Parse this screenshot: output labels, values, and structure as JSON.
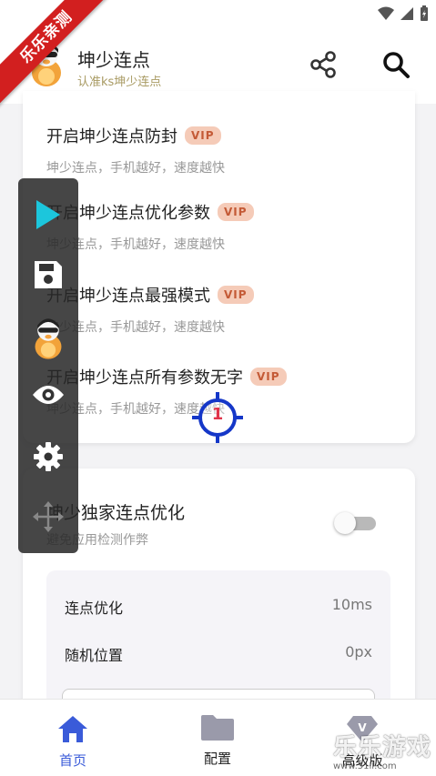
{
  "ribbon": "乐乐亲测",
  "header": {
    "title": "坤少连点",
    "subtitle": "认准ks坤少连点"
  },
  "options": [
    {
      "title": "开启坤少连点防封",
      "badge": "VIP",
      "desc": "坤少连点，手机越好，速度越快"
    },
    {
      "title": "开启坤少连点优化参数",
      "badge": "VIP",
      "desc": "坤少连点，手机越好，速度越快"
    },
    {
      "title": "开启坤少连点最强模式",
      "badge": "VIP",
      "desc": "坤少连点，手机越好，速度越快"
    },
    {
      "title": "开启坤少连点所有参数无字",
      "badge": "VIP",
      "desc": "坤少连点，手机越好，速度越快"
    }
  ],
  "optimize": {
    "title": "坤少独家连点优化",
    "subtitle": "避免应用检测作弊",
    "toggle_on": false,
    "settings": [
      {
        "label": "连点优化",
        "value": "10ms"
      },
      {
        "label": "随机位置",
        "value": "0px"
      }
    ]
  },
  "target": {
    "number": "1"
  },
  "float_panel": [
    "play-icon",
    "save-icon",
    "avatar",
    "eye-icon",
    "gear-icon",
    "move-icon"
  ],
  "nav": {
    "items": [
      {
        "label": "首页",
        "icon": "home-icon",
        "active": true
      },
      {
        "label": "配置",
        "icon": "folder-icon",
        "active": false
      },
      {
        "label": "高级版",
        "icon": "vip-gem-icon",
        "active": false
      }
    ]
  },
  "watermark": {
    "text": "乐乐游戏",
    "url": "www.51ll.com"
  },
  "colors": {
    "accent": "#3a5bd9",
    "vip_bg": "#f5cbb8",
    "vip_text": "#c45a36",
    "ribbon": "#d21f1f",
    "play": "#1cc6dc",
    "target": "#1537c8"
  }
}
